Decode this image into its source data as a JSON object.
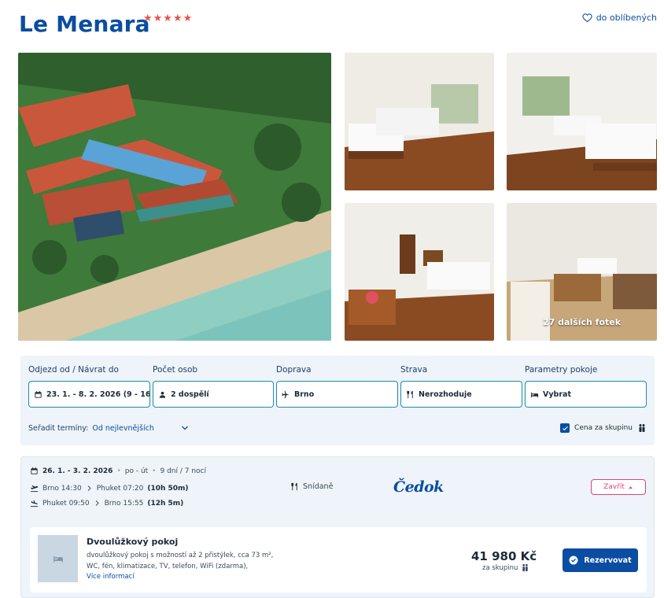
{
  "hotel": {
    "name": "Le Menara",
    "stars": "★★★★★",
    "favorite_label": "do oblíbených"
  },
  "gallery": {
    "more_photos_label": "27 dalších fotek"
  },
  "filters": {
    "dates": {
      "label": "Odjezd od / Návrat do",
      "value": "23. 1. - 8. 2. 2026 (9 - 16 d..."
    },
    "persons": {
      "label": "Počet osob",
      "value": "2 dospělí"
    },
    "transport": {
      "label": "Doprava",
      "value": "Brno"
    },
    "board": {
      "label": "Strava",
      "value": "Nerozhoduje"
    },
    "room": {
      "label": "Parametry pokoje",
      "value": "Vybrat"
    },
    "sort_label": "Seřadit termíny:",
    "sort_value": "Od nejlevnějších",
    "group_price_label": "Cena za skupinu"
  },
  "result": {
    "date_range": "26. 1. - 3. 2. 2026",
    "weekdays": "po - út",
    "duration": "9 dní / 7 nocí",
    "outbound": {
      "from": "Brno 14:30",
      "to": "Phuket 07:20",
      "duration": "(10h 50m)"
    },
    "return": {
      "from": "Phuket 09:50",
      "to": "Brno 15:55",
      "duration": "(12h 5m)"
    },
    "meal": "Snídaně",
    "operator": "Čedok",
    "close_label": "Zavřít",
    "room": {
      "name": "Dvoulůžkový pokoj",
      "desc_line1": "dvoulůžkový pokoj s možností až 2 přistýlek, cca 73 m²,",
      "desc_line2": "WC, fén, klimatizace, TV, telefon, WiFi (zdarma),",
      "more_info": "Více informací",
      "price": "41 980 Kč",
      "price_note": "za skupinu",
      "book_label": "Rezervovat"
    }
  },
  "colors": {
    "brand": "#0a4da2",
    "stars": "#e3564a",
    "panel": "#eef4f9",
    "close": "#d9457a"
  },
  "icons": [
    "heart-icon",
    "calendar-icon",
    "person-icon",
    "plane-icon",
    "cutlery-icon",
    "bed-icon",
    "chevron-down-icon",
    "checkbox-icon",
    "group-icon",
    "plane-landing-icon",
    "chevron-right-icon",
    "caret-up-icon",
    "check-circle-icon"
  ]
}
